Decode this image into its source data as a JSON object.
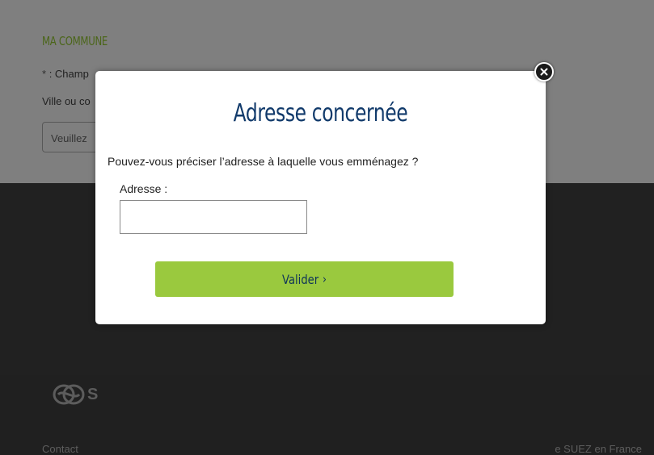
{
  "background": {
    "section_title": "MA COMMUNE",
    "required_asterisk": "*",
    "required_text": ": Champ",
    "city_label": "Ville ou co",
    "city_placeholder": "Veuillez",
    "footer": {
      "logo_letter": "S",
      "contact_link": "Contact",
      "suez_link": "e SUEZ en France"
    }
  },
  "modal": {
    "title": "Adresse concernée",
    "question": "Pouvez-vous préciser l’adresse à laquelle vous emménagez ?",
    "address_label": "Adresse :",
    "address_value": "",
    "validate_label": "Valider",
    "validate_icon": "chevron-right-icon",
    "close_icon": "close-icon"
  },
  "colors": {
    "overlay_bg": "#7f7f7f",
    "footer_bg": "#212121",
    "accent_green": "#9ac93e",
    "title_blue": "#113a6b"
  }
}
